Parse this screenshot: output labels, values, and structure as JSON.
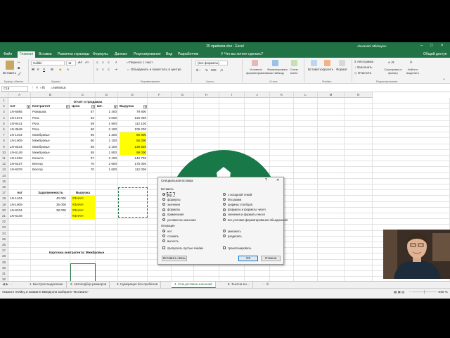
{
  "window": {
    "title": "25 приёмов.xlsx - Excel",
    "user": "Alexander Mikhaylov",
    "share": "Общий доступ",
    "search_hint": "Что вы хотите сделать?"
  },
  "menu": {
    "tabs": [
      "Файл",
      "Главная",
      "Вставка",
      "Разметка страницы",
      "Формулы",
      "Данные",
      "Рецензирование",
      "Вид",
      "Разработчик"
    ]
  },
  "ribbon": {
    "paste": "Вставить",
    "font_name": "Calibri",
    "font_size": "11",
    "wrap_text": "Перенос с текст",
    "merge": "Объединить и поместить в центре",
    "number_format": "(все форматы)",
    "cond_format": "Условное форматирование",
    "format_table": "Форматировать как таблицу",
    "cell_styles": "Стили ячеек",
    "insert": "Вставить",
    "delete": "Удалить",
    "format": "Формат",
    "autosum": "Автосумма",
    "fill": "Заполнить",
    "clear": "Очистить",
    "sort": "Сортировка и фильтр",
    "find": "Найти и выделить",
    "groups": {
      "clipboard": "Буфер обмена",
      "font": "Шрифт",
      "alignment": "Выравнивание",
      "number": "Число",
      "styles": "Стили",
      "cells": "Ячейки",
      "editing": "Редактирование"
    }
  },
  "formula_bar": {
    "name_box": "C18",
    "fx": "fx",
    "formula": "=ЛИП!И18"
  },
  "grid": {
    "columns": [
      "A",
      "B",
      "C",
      "D",
      "E",
      "F",
      "G",
      "H",
      "I",
      "J",
      "K",
      "L",
      "M",
      "N"
    ],
    "rows": [
      "1",
      "2",
      "3",
      "4",
      "5",
      "6",
      "7",
      "8",
      "9",
      "10",
      "11",
      "12",
      "13",
      "14",
      "15",
      "16",
      "17",
      "18",
      "19",
      "20",
      "21",
      "22",
      "23",
      "24",
      "25",
      "26",
      "27",
      "28",
      "29",
      "30",
      "31",
      "32"
    ],
    "report_title": "Отчет о продажах",
    "headers": [
      "Акт",
      "Контрагент",
      "Цена",
      "Шт.",
      "Выручка"
    ],
    "data": [
      [
        "LN-5685",
        "Ромашка",
        "57",
        "1 400",
        "79 800",
        false
      ],
      [
        "LN-1574",
        "Рога",
        "63",
        "2 000",
        "126 000",
        false
      ],
      [
        "LN-9441",
        "Рога",
        "59",
        "1 900",
        "112 100",
        false
      ],
      [
        "LN-3649",
        "Рога",
        "50",
        "2 100",
        "109 200",
        false
      ],
      [
        "LN-1404",
        "Межбровье",
        "66",
        "1 300",
        "85 800",
        true
      ],
      [
        "LN-1909",
        "Межбровье",
        "50",
        "1 100",
        "55 000",
        true
      ],
      [
        "LN-9234",
        "Межбровье",
        "66",
        "2 100",
        "138 600",
        true
      ],
      [
        "LN-6149",
        "Межбровье",
        "55",
        "1 800",
        "99 000",
        true
      ],
      [
        "LN-1918",
        "Копыта",
        "67",
        "2 100",
        "140 700",
        false
      ],
      [
        "LN-5427",
        "Вектор",
        "70",
        "2 500",
        "175 000",
        false
      ],
      [
        "LN-6078",
        "Вектор",
        "70",
        "1 600",
        "112 000",
        false
      ]
    ],
    "card_title": "Карточка контрагента: Межбровье",
    "card_headers": [
      "Акт",
      "Задолженность",
      "Выручка"
    ],
    "card_rows": [
      [
        "LN-1404",
        "40 000",
        "#ЗНАЧ!"
      ],
      [
        "LN-1909",
        "35 000",
        "#ЗНАЧ!"
      ],
      [
        "LN-9234",
        "38 000",
        "#ЗНАЧ!"
      ],
      [
        "LN-6149",
        "-",
        "#ЗНАЧ!"
      ]
    ]
  },
  "dialog": {
    "title": "Специальная вставка",
    "help": "?",
    "close": "✕",
    "paste_section": "Вставить",
    "paste_left": [
      "все",
      "формулы",
      "значения",
      "форматы",
      "примечания",
      "условия на значения"
    ],
    "paste_right": [
      "с исходной темой",
      "без рамки",
      "ширины столбцов",
      "формулы и форматы чисел",
      "значения и форматы чисел",
      "все условия форматирования объединения"
    ],
    "paste_selected": 0,
    "op_section": "Операция",
    "op_left": [
      "нет",
      "сложить",
      "вычесть"
    ],
    "op_right": [
      "умножить",
      "разделить"
    ],
    "op_selected": 0,
    "skip_blanks": "пропускать пустые ячейки",
    "transpose": "транспонировать",
    "paste_link": "Вставить связь",
    "ok": "ОК",
    "cancel": "Отмена"
  },
  "sheet_tabs": [
    "1. Быстрое выделение",
    "2. Автоподбор размеров",
    "3. Нумерация без пробелов",
    "4. Спец.вставка значений",
    "5. Тысячи в к..."
  ],
  "active_sheet_tab": 3,
  "status": {
    "message": "Укажите ячейку и нажмите ВВОД или выберите \"Вставить\"",
    "zoom": "100 %"
  },
  "colors": {
    "excel_green": "#217346",
    "logo_green": "#197847",
    "highlight_yellow": "#ffff00"
  }
}
